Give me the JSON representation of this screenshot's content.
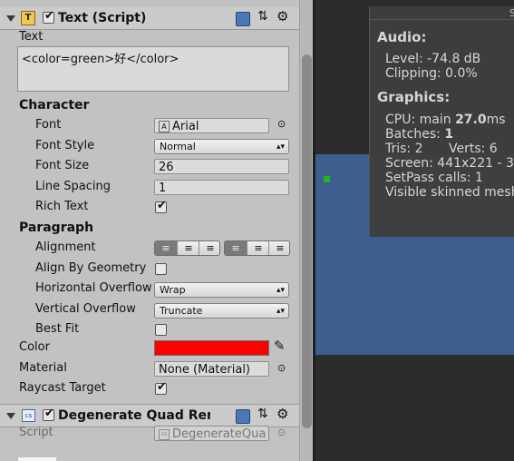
{
  "inspector": {
    "text_component": {
      "title": "Text (Script)",
      "text_label": "Text",
      "text_value": "<color=green>好</color>",
      "character_header": "Character",
      "font_label": "Font",
      "font_value": "Arial",
      "font_style_label": "Font Style",
      "font_style_value": "Normal",
      "font_size_label": "Font Size",
      "font_size_value": "26",
      "line_spacing_label": "Line Spacing",
      "line_spacing_value": "1",
      "rich_text_label": "Rich Text",
      "rich_text_checked": true,
      "paragraph_header": "Paragraph",
      "alignment_label": "Alignment",
      "align_by_geometry_label": "Align By Geometry",
      "align_by_geometry_checked": false,
      "horizontal_overflow_label": "Horizontal Overflow",
      "horizontal_overflow_value": "Wrap",
      "vertical_overflow_label": "Vertical Overflow",
      "vertical_overflow_value": "Truncate",
      "best_fit_label": "Best Fit",
      "best_fit_checked": false,
      "color_label": "Color",
      "color_value": "#ff0000",
      "material_label": "Material",
      "material_value": "None (Material)",
      "raycast_label": "Raycast Target",
      "raycast_checked": true
    },
    "second_component": {
      "title": "Degenerate Quad Ren",
      "script_label": "Script",
      "script_value": "DegenerateQua"
    }
  },
  "game_view": {
    "quad_color": "#3d5f8f",
    "stats": {
      "tab_label": "S",
      "audio_header": "Audio:",
      "level": "Level: -74.8 dB",
      "clipping": "Clipping: 0.0%",
      "graphics_header": "Graphics:",
      "cpu_prefix": "CPU: main ",
      "cpu_value": "27.0",
      "cpu_suffix": "ms",
      "batches_prefix": "Batches: ",
      "batches_value": "1",
      "tris": "Tris: 2",
      "verts": "Verts: 6",
      "screen": "Screen: 441x221 - 3",
      "setpass": "SetPass calls: 1",
      "skinned": "Visible skinned mesh"
    }
  }
}
